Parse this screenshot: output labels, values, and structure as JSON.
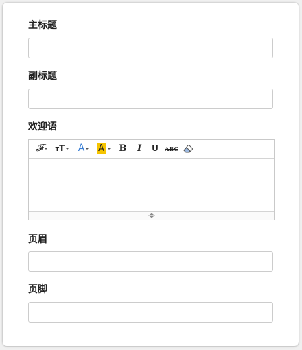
{
  "fields": {
    "title_label": "主标题",
    "title_value": "",
    "subtitle_label": "副标题",
    "subtitle_value": "",
    "welcome_label": "欢迎语",
    "header_label": "页眉",
    "header_value": "",
    "footer_label": "页脚",
    "footer_value": ""
  },
  "editor": {
    "toolbar": {
      "font_family_glyph": "𝓕",
      "font_size_glyph": "T",
      "font_size_small_glyph": "T",
      "font_color_glyph": "A",
      "highlight_glyph": "A",
      "bold_glyph": "B",
      "italic_glyph": "I",
      "underline_glyph": "U",
      "strikethrough_glyph": "ABC",
      "icons": [
        "font-family-icon",
        "font-size-icon",
        "font-color-icon",
        "highlight-icon",
        "bold-icon",
        "italic-icon",
        "underline-icon",
        "strikethrough-icon",
        "eraser-icon"
      ]
    },
    "content": ""
  },
  "colors": {
    "font_color_accent": "#3a7fd5",
    "highlight_color": "#f5c400",
    "input_border": "#cccccc"
  }
}
